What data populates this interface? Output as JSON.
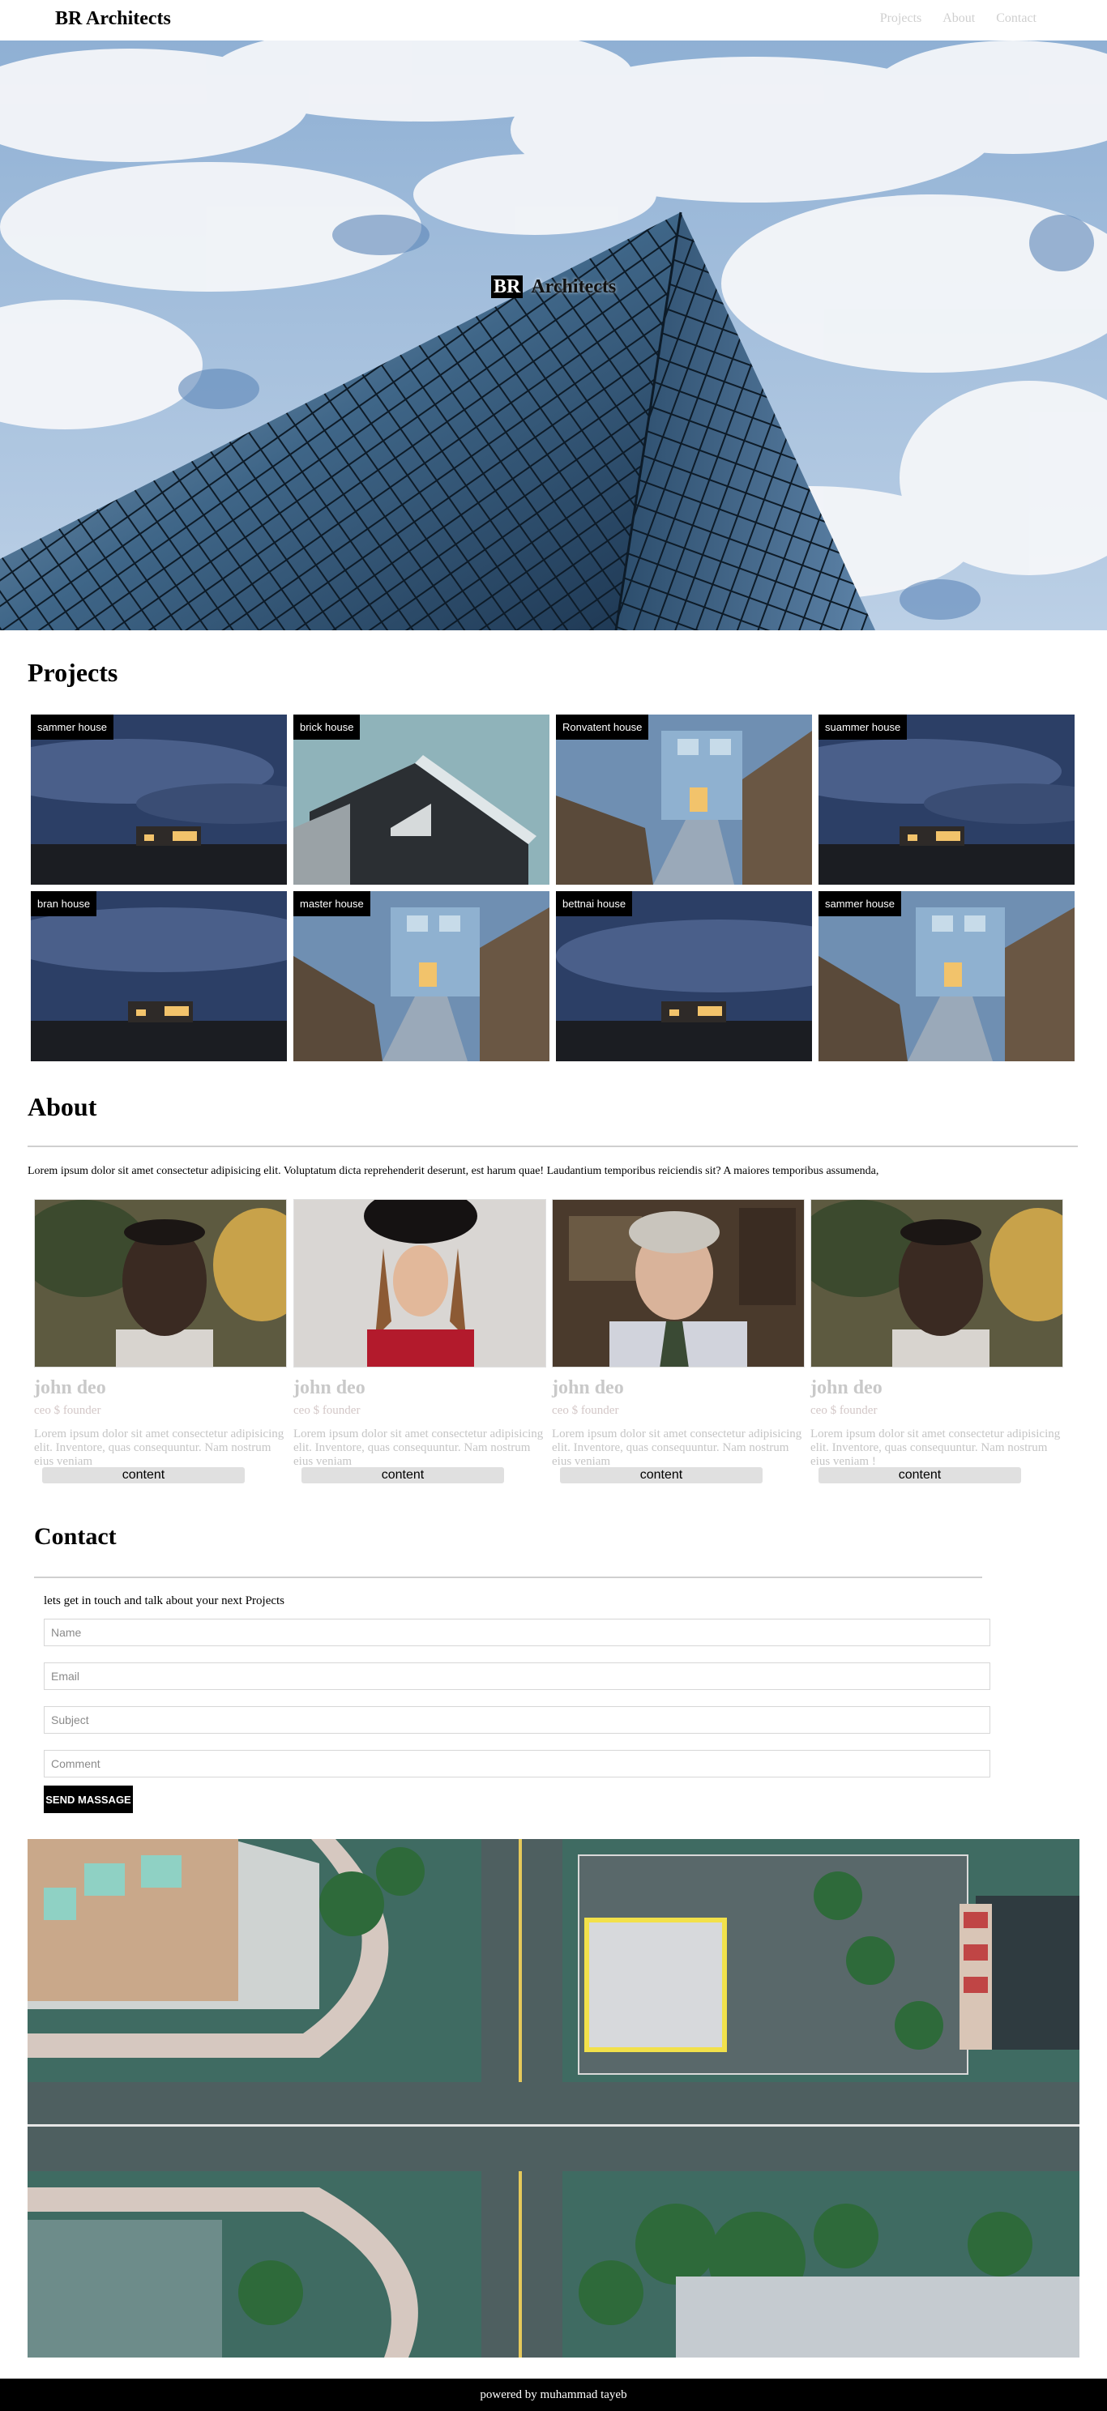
{
  "nav": {
    "brand": "BR Architects",
    "links": [
      "Projects",
      "About",
      "Contact"
    ]
  },
  "hero": {
    "badge": "BR",
    "title": "Architects"
  },
  "projects": {
    "heading": "Projects",
    "items": [
      {
        "label": "sammer house"
      },
      {
        "label": "brick house"
      },
      {
        "label": "Ronvatent house"
      },
      {
        "label": "suammer house"
      },
      {
        "label": "bran house"
      },
      {
        "label": "master house"
      },
      {
        "label": "bettnai house"
      },
      {
        "label": "sammer house"
      }
    ]
  },
  "about": {
    "heading": "About",
    "text": "Lorem ipsum dolor sit amet consectetur adipisicing elit. Voluptatum dicta reprehenderit deserunt, est harum quae! Laudantium temporibus reiciendis sit? A maiores temporibus assumenda,",
    "team": [
      {
        "name": "john deo",
        "role": "ceo $ founder",
        "desc": "Lorem ipsum dolor sit amet consectetur adipisicing elit. Inventore, quas consequuntur. Nam nostrum eius veniam",
        "button": "content"
      },
      {
        "name": "john deo",
        "role": "ceo $ founder",
        "desc": "Lorem ipsum dolor sit amet consectetur adipisicing elit. Inventore, quas consequuntur. Nam nostrum eius veniam",
        "button": "content"
      },
      {
        "name": "john deo",
        "role": "ceo $ founder",
        "desc": "Lorem ipsum dolor sit amet consectetur adipisicing elit. Inventore, quas consequuntur. Nam nostrum eius veniam",
        "button": "content"
      },
      {
        "name": "john deo",
        "role": "ceo $ founder",
        "desc": "Lorem ipsum dolor sit amet consectetur adipisicing elit. Inventore, quas consequuntur. Nam nostrum eius veniam !",
        "button": "content"
      }
    ]
  },
  "contact": {
    "heading": "Contact",
    "intro": "lets get in touch and talk about your next Projects",
    "fields": {
      "name_placeholder": "Name",
      "email_placeholder": "Email",
      "subject_placeholder": "Subject",
      "comment_placeholder": "Comment"
    },
    "send_label": "SEND MASSAGE"
  },
  "footer": {
    "text": "powered by muhammad tayeb"
  },
  "colors": {
    "nav_link": "#cfcfcf",
    "footer_bg": "#000000",
    "button_bg": "#000000",
    "team_text": "#c9c9c9"
  }
}
